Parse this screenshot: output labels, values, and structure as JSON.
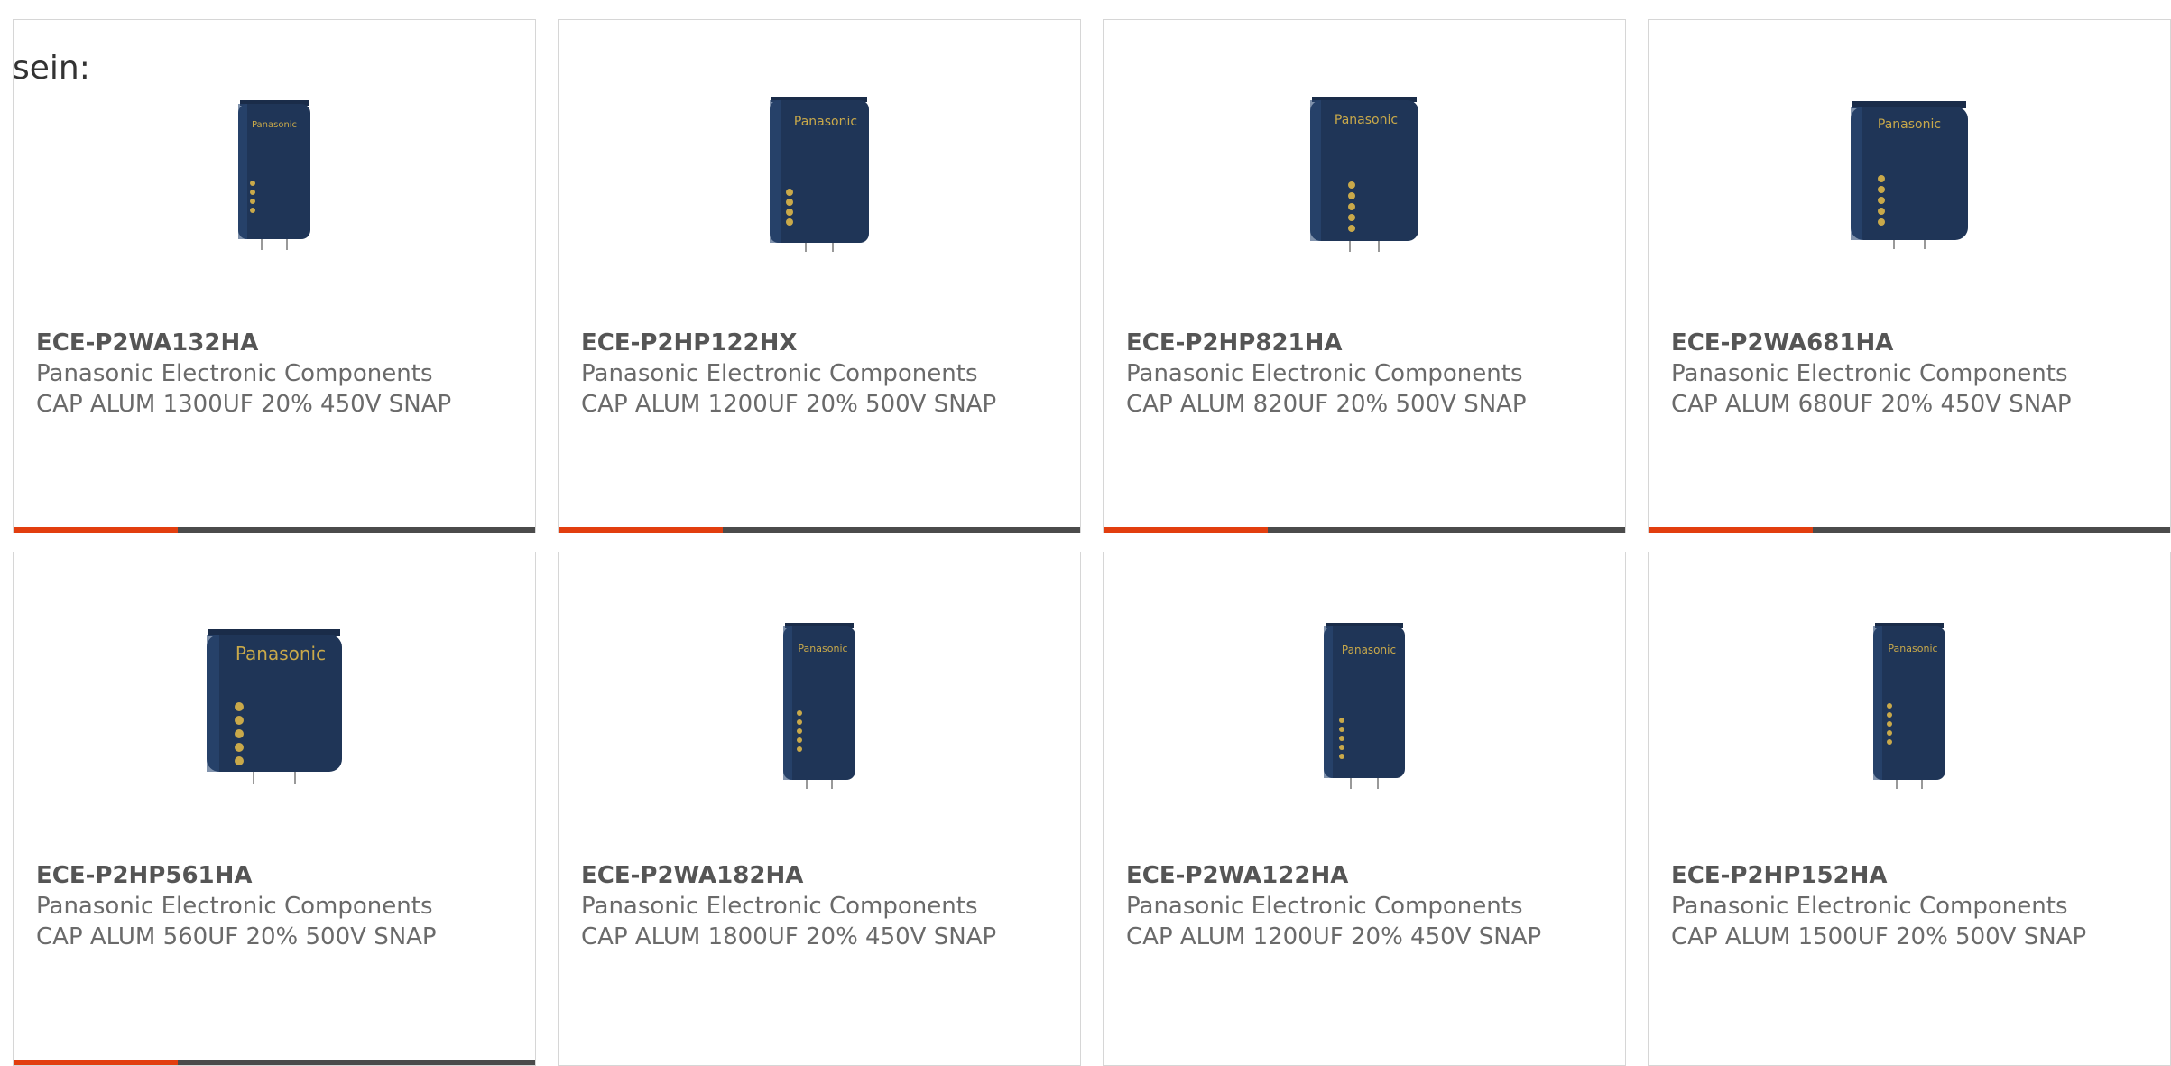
{
  "lead_text": "sein:",
  "colors": {
    "accent": "#e23e0f",
    "bar": "#4b4b4b",
    "cap_body": "#1f3557",
    "cap_label": "#c9a94a"
  },
  "products": [
    {
      "part_number": "ECE-P2WA132HA",
      "manufacturer": "Panasonic Electronic Components",
      "description": "CAP ALUM 1300UF 20% 450V SNAP",
      "image_icon": "capacitor-icon"
    },
    {
      "part_number": "ECE-P2HP122HX",
      "manufacturer": "Panasonic Electronic Components",
      "description": "CAP ALUM 1200UF 20% 500V SNAP",
      "image_icon": "capacitor-icon"
    },
    {
      "part_number": "ECE-P2HP821HA",
      "manufacturer": "Panasonic Electronic Components",
      "description": "CAP ALUM 820UF 20% 500V SNAP",
      "image_icon": "capacitor-icon"
    },
    {
      "part_number": "ECE-P2WA681HA",
      "manufacturer": "Panasonic Electronic Components",
      "description": "CAP ALUM 680UF 20% 450V SNAP",
      "image_icon": "capacitor-icon"
    },
    {
      "part_number": "ECE-P2HP561HA",
      "manufacturer": "Panasonic Electronic Components",
      "description": "CAP ALUM 560UF 20% 500V SNAP",
      "image_icon": "capacitor-icon"
    },
    {
      "part_number": "ECE-P2WA182HA",
      "manufacturer": "Panasonic Electronic Components",
      "description": "CAP ALUM 1800UF 20% 450V SNAP",
      "image_icon": "capacitor-icon"
    },
    {
      "part_number": "ECE-P2WA122HA",
      "manufacturer": "Panasonic Electronic Components",
      "description": "CAP ALUM 1200UF 20% 450V SNAP",
      "image_icon": "capacitor-icon"
    },
    {
      "part_number": "ECE-P2HP152HA",
      "manufacturer": "Panasonic Electronic Components",
      "description": "CAP ALUM 1500UF 20% 500V SNAP",
      "image_icon": "capacitor-icon"
    }
  ]
}
